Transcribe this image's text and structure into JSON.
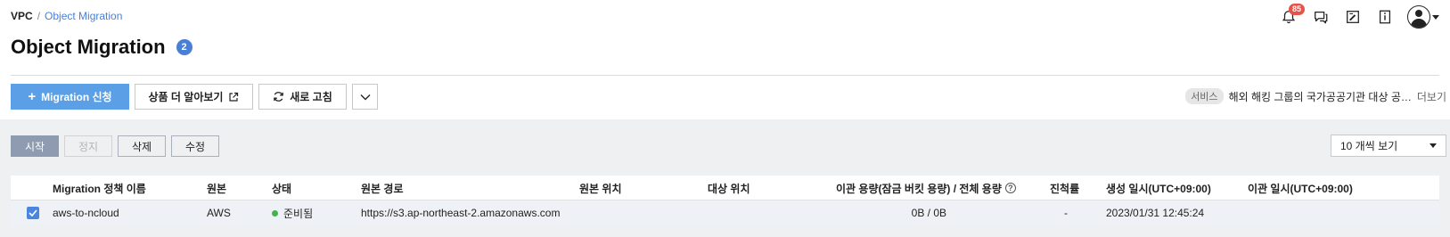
{
  "breadcrumb": {
    "root": "VPC",
    "separator": "/",
    "current": "Object Migration"
  },
  "header": {
    "notification_count": "85"
  },
  "page": {
    "title": "Object Migration",
    "count": "2"
  },
  "toolbar": {
    "migration_request": "Migration 신청",
    "learn_more": "상품 더 알아보기",
    "refresh": "새로 고침"
  },
  "notice": {
    "tag": "서비스",
    "text": "해외 해킹 그룹의 국가공공기관 대상 공…",
    "more": "더보기"
  },
  "actions": {
    "start": "시작",
    "stop": "정지",
    "delete": "삭제",
    "edit": "수정"
  },
  "pagesize": {
    "selected": "10 개씩 보기"
  },
  "table": {
    "columns": {
      "name": "Migration 정책 이름",
      "source": "원본",
      "status": "상태",
      "source_path": "원본 경로",
      "source_location": "원본 위치",
      "target_location": "대상 위치",
      "capacity": "이관 용량(잠금 버킷 용량) / 전체 용량",
      "progress": "진척률",
      "created": "생성 일시(UTC+09:00)",
      "migrated": "이관 일시(UTC+09:00)"
    },
    "rows": [
      {
        "name": "aws-to-ncloud",
        "source": "AWS",
        "status": "준비됨",
        "source_path": "https://s3.ap-northeast-2.amazonaws.com",
        "source_location": "",
        "target_location": "",
        "capacity": "0B / 0B",
        "progress": "-",
        "created": "2023/01/31 12:45:24",
        "migrated": ""
      }
    ]
  },
  "colors": {
    "primary": "#5ba0e6",
    "accent": "#4a7fd8",
    "status_ready": "#3fb54a",
    "badge": "#e5534b"
  }
}
